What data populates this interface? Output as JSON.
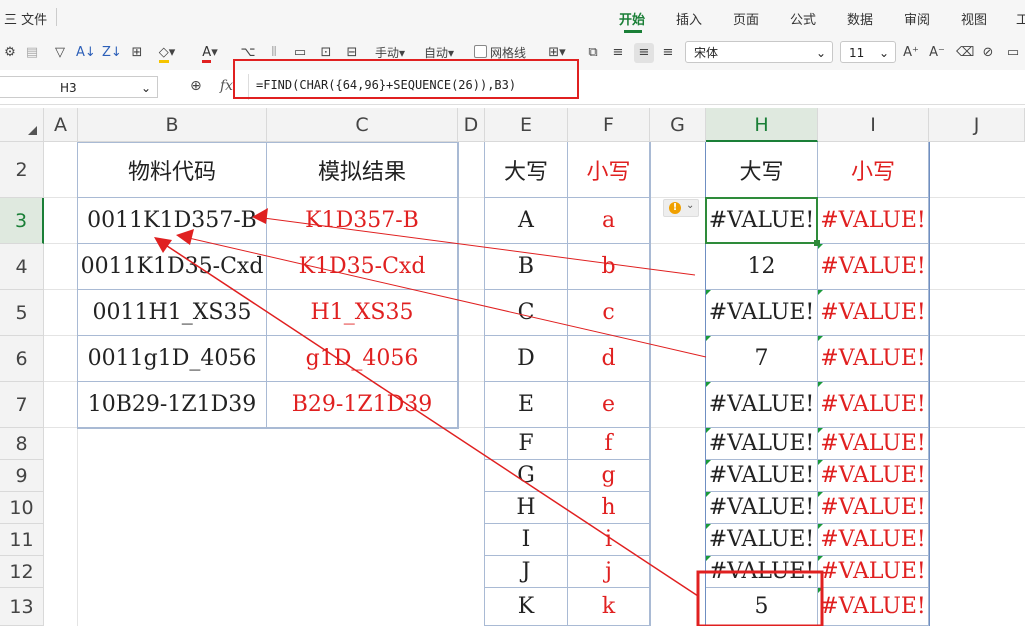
{
  "menubar": {
    "file_menu": "三 文件",
    "tabs": [
      "开始",
      "插入",
      "页面",
      "公式",
      "数据",
      "审阅",
      "视图",
      "工"
    ]
  },
  "toolbar": {
    "fill_color": "#f5c400",
    "font_color": "#e02020",
    "row_height_label": "手动",
    "col_width_label": "自动",
    "gridlines_label": "网格线",
    "font_name": "宋体",
    "font_size": "11"
  },
  "formula_bar": {
    "cell_ref": "H3",
    "fx_label": "fx",
    "formula": "=FIND(CHAR({64,96}+SEQUENCE(26)),B3)"
  },
  "sheet": {
    "columns": [
      "A",
      "B",
      "C",
      "D",
      "E",
      "F",
      "G",
      "H",
      "I",
      "J"
    ],
    "selected_column": "H",
    "rows": [
      "2",
      "3",
      "4",
      "5",
      "6",
      "7",
      "8",
      "9",
      "10",
      "11",
      "12",
      "13"
    ],
    "selected_row": "3",
    "left_table": {
      "headers": [
        "物料代码",
        "模拟结果"
      ],
      "rows": [
        [
          "0011K1D357-B",
          "K1D357-B"
        ],
        [
          "0011K1D35-Cxd",
          "K1D35-Cxd"
        ],
        [
          "0011H1_XS35",
          "H1_XS35"
        ],
        [
          "0011g1D_4056",
          "g1D_4056"
        ],
        [
          "10B29-1Z1D39",
          "B29-1Z1D39"
        ]
      ]
    },
    "letters": {
      "upper_header": "大写",
      "lower_header": "小写",
      "upper": [
        "A",
        "B",
        "C",
        "D",
        "E",
        "F",
        "G",
        "H",
        "I",
        "J",
        "K"
      ],
      "lower": [
        "a",
        "b",
        "c",
        "d",
        "e",
        "f",
        "g",
        "h",
        "i",
        "j",
        "k"
      ]
    },
    "result": {
      "upper_header": "大写",
      "lower_header": "小写",
      "upper": [
        "#VALUE!",
        "12",
        "#VALUE!",
        "7",
        "#VALUE!",
        "#VALUE!",
        "#VALUE!",
        "#VALUE!",
        "#VALUE!",
        "#VALUE!",
        "5"
      ],
      "lower": [
        "#VALUE!",
        "#VALUE!",
        "#VALUE!",
        "#VALUE!",
        "#VALUE!",
        "#VALUE!",
        "#VALUE!",
        "#VALUE!",
        "#VALUE!",
        "#VALUE!",
        "#VALUE!"
      ]
    },
    "error_indicator": "!",
    "accent_color": "#1a7f37",
    "annotation_color": "#e02020"
  }
}
